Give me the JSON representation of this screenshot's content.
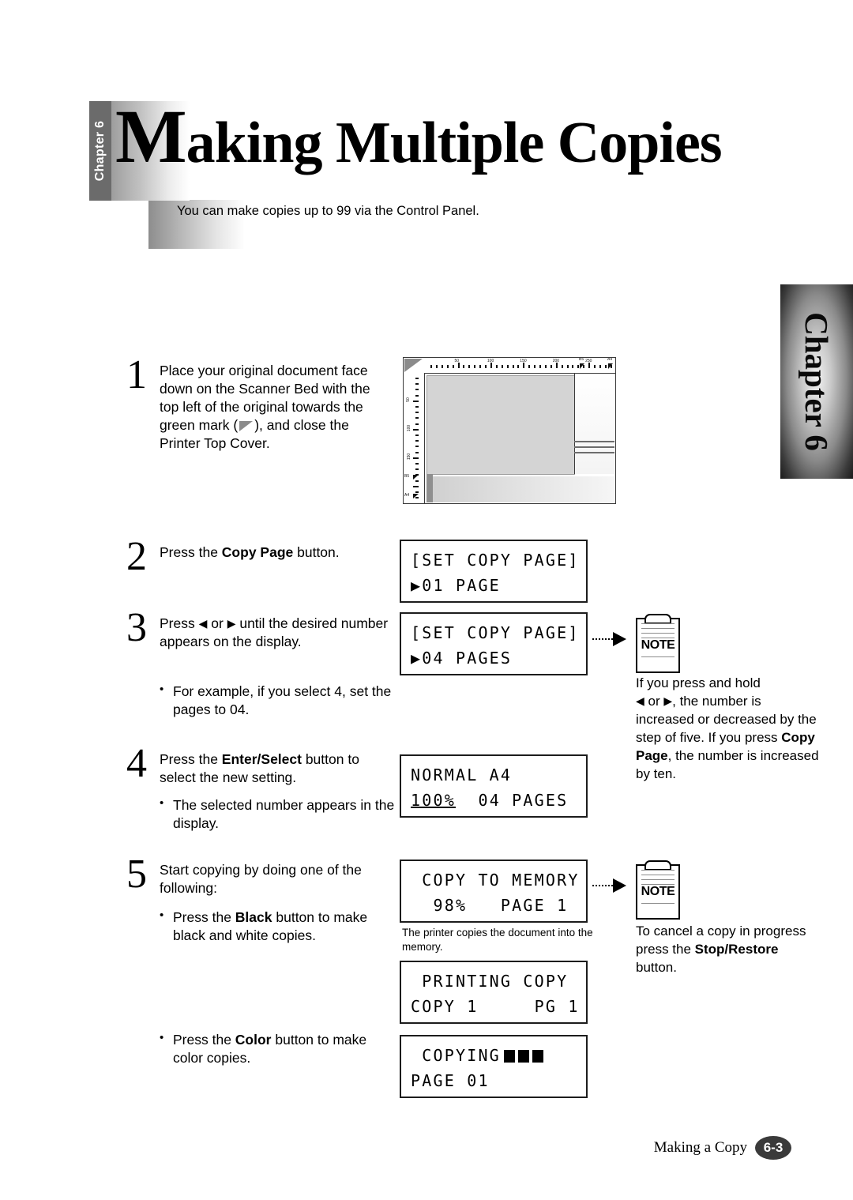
{
  "header": {
    "chapter_tab_label": "Chapter 6",
    "title_cap": "M",
    "title_rest": "aking Multiple Copies",
    "intro": "You can make copies up to 99 via the Control Panel."
  },
  "side_tab": {
    "label": "Chapter 6"
  },
  "steps": [
    {
      "number": "1",
      "text_before_mark": "Place your original document face down on the Scanner Bed with the top left of the original towards the green mark (",
      "text_after_mark": "), and close the Printer Top Cover."
    },
    {
      "number": "2",
      "text": "Press the ",
      "bold": "Copy Page",
      "text_after": " button."
    },
    {
      "number": "3",
      "text_part1": "Press ",
      "arrow_left": "◀",
      "text_part2": " or ",
      "arrow_right": "▶",
      "text_part3": " until the desired number appears on the display.",
      "bullets": [
        "For example, if you select 4, set the pages to 04."
      ]
    },
    {
      "number": "4",
      "text": "Press the ",
      "bold": "Enter/Select",
      "text_after": " button to select the new setting.",
      "bullets": [
        "The selected number appears in the display."
      ]
    },
    {
      "number": "5",
      "text": "Start copying by doing one of the following:",
      "bullet_black_pre": "Press the ",
      "bullet_black_bold": "Black",
      "bullet_black_post": " button to make black and white copies.",
      "bullet_color_pre": "Press the ",
      "bullet_color_bold": "Color",
      "bullet_color_post": " button to make color copies."
    }
  ],
  "lcd_panels": [
    {
      "name": "set-copy-page-01",
      "line1": "[SET COPY PAGE]",
      "line2": "▶01 PAGE"
    },
    {
      "name": "set-copy-page-04",
      "line1": "[SET COPY PAGE]",
      "line2": "▶04 PAGES"
    },
    {
      "name": "normal-a4",
      "line1": "NORMAL A4",
      "line2_a": "100%",
      "line2_b": "  04 PAGES"
    },
    {
      "name": "copy-to-memory",
      "line1": " COPY TO MEMORY",
      "line2": "  98%   PAGE 1"
    },
    {
      "name": "printing-copy",
      "line1": " PRINTING COPY",
      "line2": "COPY 1     PG 1"
    },
    {
      "name": "copying",
      "line1": " COPYING",
      "line2": "PAGE 01"
    }
  ],
  "lcd_caption": "The printer copies the document into the memory.",
  "notes": [
    {
      "icon_label": "NOTE",
      "line1": "If you press and hold",
      "arrow_left": "◀",
      "line2_mid": " or ",
      "arrow_right": "▶",
      "line2_end": ", the number",
      "line3": "is increased or decreased by the step of five.",
      "line4_pre": "If you press ",
      "line4_bold": "Copy Page",
      "line4_post": ", the number is increased by ten."
    },
    {
      "icon_label": "NOTE",
      "text_pre": "To cancel a copy in progress press the ",
      "text_bold": "Stop/Restore",
      "text_post": " button."
    }
  ],
  "scanner": {
    "top_ruler_labels": [
      "50",
      "100",
      "150",
      "200",
      "250"
    ],
    "top_size_marks": [
      "B5",
      "A4"
    ],
    "left_ruler_labels": [
      "50",
      "100",
      "150"
    ],
    "left_size_marks": [
      "B5",
      "A4"
    ]
  },
  "footer": {
    "label": "Making a Copy",
    "page": "6-3"
  }
}
